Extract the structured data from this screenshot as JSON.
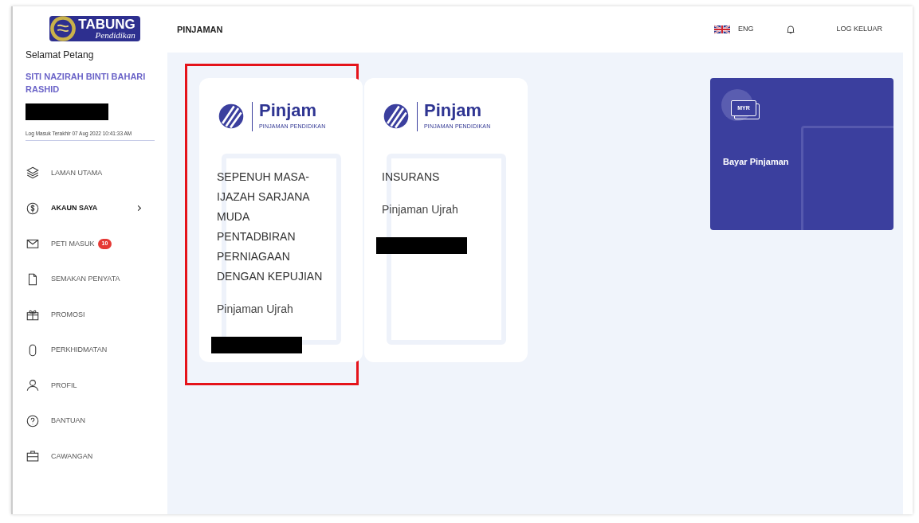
{
  "logo": {
    "title": "TABUNG",
    "subtitle": "Pendidikan"
  },
  "header": {
    "title": "PINJAMAN",
    "language": "ENG",
    "logout": "LOG KELUAR"
  },
  "user": {
    "greeting": "Selamat Petang",
    "name": "SITI NAZIRAH BINTI BAHARI RASHID",
    "redacted": true,
    "last_login": "Log Masuk Terakhir 07 Aug 2022 10:41:33 AM"
  },
  "nav": [
    {
      "kind": "layers",
      "label": "LAMAN UTAMA",
      "selected": false
    },
    {
      "kind": "dollar",
      "label": "AKAUN SAYA",
      "selected": true,
      "submenu": true
    },
    {
      "kind": "mail",
      "label": "PETI MASUK",
      "selected": false,
      "badge": "10"
    },
    {
      "kind": "file",
      "label": "SEMAKAN PENYATA",
      "selected": false
    },
    {
      "kind": "gift",
      "label": "PROMOSI",
      "selected": false
    },
    {
      "kind": "mouse",
      "label": "PERKHIDMATAN",
      "selected": false
    },
    {
      "kind": "user",
      "label": "PROFIL",
      "selected": false
    },
    {
      "kind": "help",
      "label": "BANTUAN",
      "selected": false
    },
    {
      "kind": "briefcase",
      "label": "CAWANGAN",
      "selected": false
    }
  ],
  "loans": [
    {
      "brand": "Pinjam",
      "brand_sub": "PINJAMAN PENDIDIKAN",
      "title": "SEPENUH MASA-\nIJAZAH SARJANA\nMUDA\nPENTADBIRAN\nPERNIAGAAN\nDENGAN KEPUJIAN",
      "type": "Pinjaman Ujrah",
      "redacted": true,
      "highlighted": true
    },
    {
      "brand": "Pinjam",
      "brand_sub": "PINJAMAN PENDIDIKAN",
      "title": "INSURANS",
      "type": "Pinjaman Ujrah",
      "redacted": true,
      "highlighted": false
    }
  ],
  "pay_card": {
    "icon_text": "MYR",
    "label": "Bayar Pinjaman"
  }
}
